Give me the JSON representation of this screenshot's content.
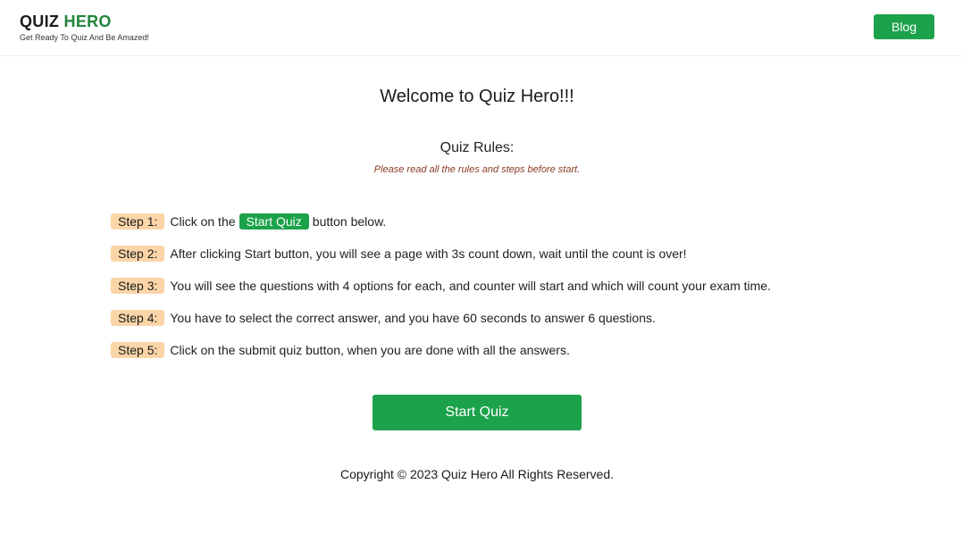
{
  "header": {
    "brand_word1": "QUIZ",
    "brand_word2": "HERO",
    "tagline": "Get Ready To Quiz And Be Amazed!",
    "blog_label": "Blog"
  },
  "main": {
    "welcome": "Welcome to Quiz Hero!!!",
    "rules_title": "Quiz Rules:",
    "rules_note": "Please read all the rules and steps before start.",
    "steps": [
      {
        "label": "Step 1:",
        "before": "Click on the",
        "highlight": "Start Quiz",
        "after": "button below."
      },
      {
        "label": "Step 2:",
        "text": "After clicking Start button, you will see a page with 3s count down, wait until the count is over!"
      },
      {
        "label": "Step 3:",
        "text": "You will see the questions with 4 options for each, and counter will start and which will count your exam time."
      },
      {
        "label": "Step 4:",
        "text": "You have to select the correct answer, and you have 60 seconds to answer 6 questions."
      },
      {
        "label": "Step 5:",
        "text": "Click on the submit quiz button, when you are done with all the answers."
      }
    ],
    "start_button_label": "Start Quiz"
  },
  "footer": {
    "copyright": "Copyright © 2023 Quiz Hero All Rights Reserved."
  },
  "colors": {
    "brand_green": "#23843b",
    "button_green": "#1ba24a",
    "step_badge": "#fbd5a8",
    "note_text": "#8a3a22"
  }
}
